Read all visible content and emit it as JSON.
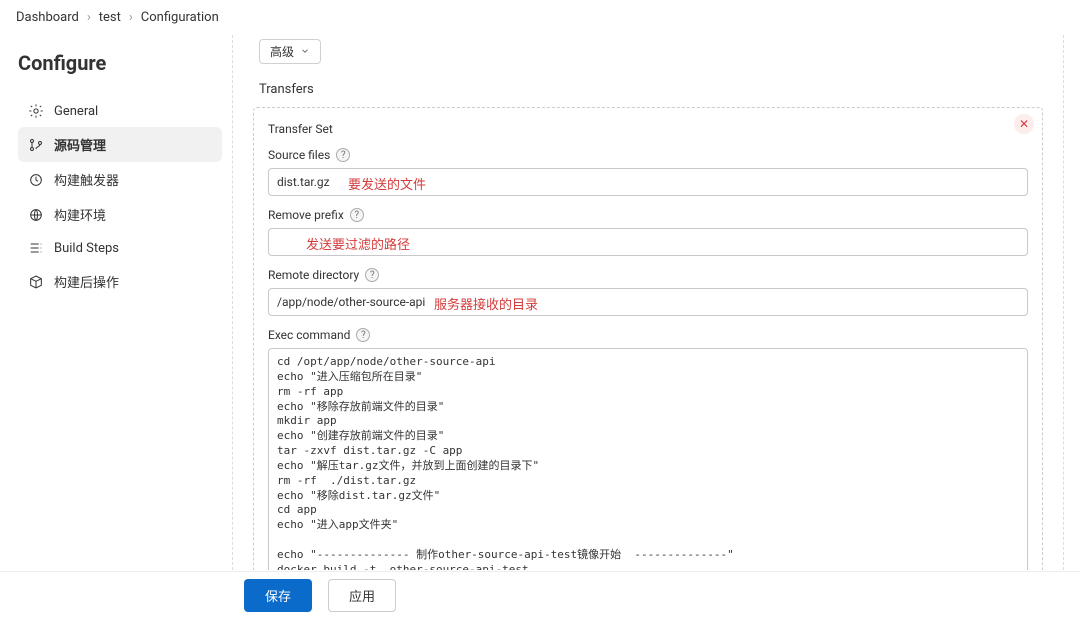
{
  "breadcrumb": {
    "items": [
      "Dashboard",
      "test",
      "Configuration"
    ]
  },
  "sidebar": {
    "title": "Configure",
    "items": [
      {
        "label": "General"
      },
      {
        "label": "源码管理"
      },
      {
        "label": "构建触发器"
      },
      {
        "label": "构建环境"
      },
      {
        "label": "Build Steps"
      },
      {
        "label": "构建后操作"
      }
    ]
  },
  "main": {
    "advanced_label": "高级",
    "transfers_title": "Transfers",
    "transfer_set_label": "Transfer Set",
    "source_files": {
      "label": "Source files",
      "value": "dist.tar.gz",
      "note": "要发送的文件"
    },
    "remove_prefix": {
      "label": "Remove prefix",
      "value": "",
      "note": "发送要过滤的路径"
    },
    "remote_directory": {
      "label": "Remote directory",
      "value": "/app/node/other-source-api",
      "note": "服务器接收的目录"
    },
    "exec_command": {
      "label": "Exec command",
      "value": "cd /opt/app/node/other-source-api\necho \"进入压缩包所在目录\"\nrm -rf app\necho \"移除存放前端文件的目录\"\nmkdir app\necho \"创建存放前端文件的目录\"\ntar -zxvf dist.tar.gz -C app\necho \"解压tar.gz文件，并放到上面创建的目录下\"\nrm -rf  ./dist.tar.gz\necho \"移除dist.tar.gz文件\"\ncd app\necho \"进入app文件夹\"\n\necho \"-------------- 制作other-source-api-test镜像开始  --------------\"\ndocker build -t  other-source-api-test .\necho \"-------------- 制作other-source-api-test镜像结束  --------------\"\n\necho \"-------------- 终止 other-source-api-test 容器 开始  --------------\"\ndocker stop other-source-api-test\necho \"-------------- 终止 other-source-api-test 容器 结束  --------------\""
    }
  },
  "footer": {
    "save": "保存",
    "apply": "应用"
  }
}
